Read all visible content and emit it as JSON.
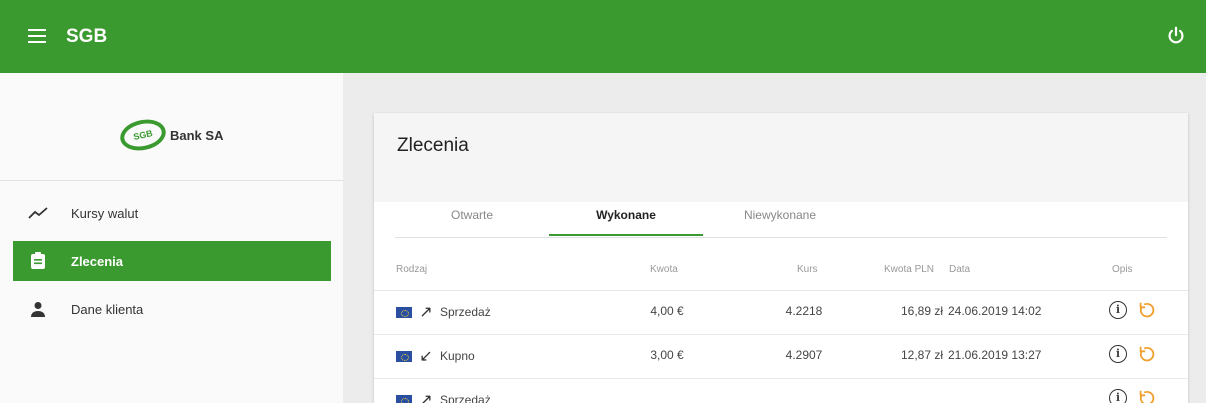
{
  "header": {
    "title": "SGB",
    "menu_icon": "menu-icon",
    "power_icon": "power-icon",
    "color": "#3a9a2f"
  },
  "sidebar": {
    "logo": {
      "mark": "SGB",
      "text": "Bank SA"
    },
    "items": [
      {
        "label": "Kursy walut",
        "icon": "trending-icon",
        "active": false
      },
      {
        "label": "Zlecenia",
        "icon": "clipboard-icon",
        "active": true
      },
      {
        "label": "Dane klienta",
        "icon": "person-icon",
        "active": false
      }
    ]
  },
  "main": {
    "title": "Zlecenia",
    "tabs": [
      {
        "label": "Otwarte",
        "active": false
      },
      {
        "label": "Wykonane",
        "active": true
      },
      {
        "label": "Niewykonane",
        "active": false
      }
    ],
    "table": {
      "columns": [
        "Rodzaj",
        "Kwota",
        "Kurs",
        "Kwota PLN",
        "Data",
        "Opis"
      ],
      "rows": [
        {
          "type": "Sprzedaż",
          "direction": "sell-arrow-icon",
          "amount": "4,00 €",
          "rate": "4.2218",
          "pln": "16,89 zł",
          "date": "24.06.2019 14:02"
        },
        {
          "type": "Kupno",
          "direction": "buy-arrow-icon",
          "amount": "3,00 €",
          "rate": "4.2907",
          "pln": "12,87 zł",
          "date": "21.06.2019 13:27"
        },
        {
          "type": "Sprzedaż",
          "direction": "sell-arrow-icon",
          "amount": "",
          "rate": "",
          "pln": "",
          "date": ""
        }
      ]
    }
  }
}
